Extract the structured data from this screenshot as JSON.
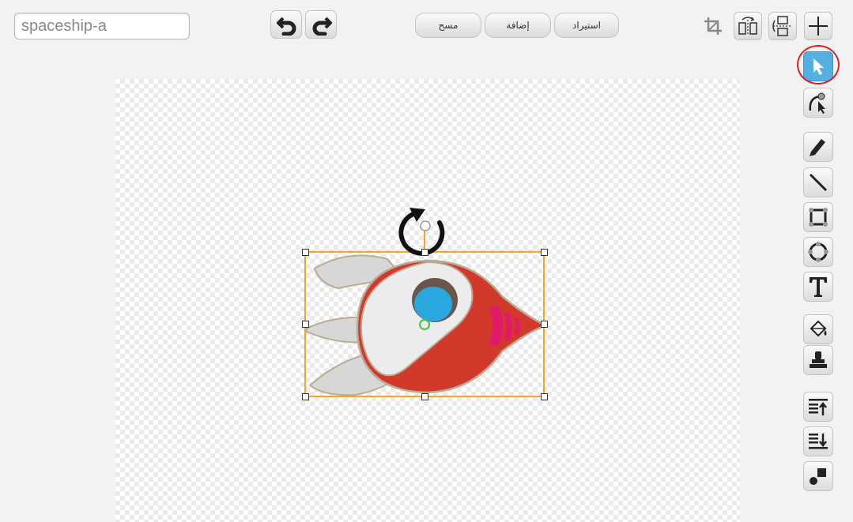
{
  "costume": {
    "name": "spaceship-a"
  },
  "toolbar": {
    "clear_label": "مسح",
    "add_label": "إضافة",
    "import_label": "استيراد"
  },
  "colors": {
    "selection_box": "#f5a623",
    "selected_tool": "#53b0e0",
    "highlight_ring": "#e02020",
    "rocket_body": "#d13a2b",
    "rocket_window": "#29a8e0",
    "rocket_stripes": "#e0196b",
    "rocket_fins": "#d7d7d7"
  },
  "icons": {
    "undo": "undo-icon",
    "redo": "redo-icon",
    "crop": "crop-icon",
    "flip_horizontal": "flip-horizontal-icon",
    "flip_vertical": "flip-vertical-icon",
    "set_center": "crosshair-icon",
    "select": "arrow-cursor-icon",
    "reshape": "reshape-icon",
    "pencil": "pencil-icon",
    "line": "line-icon",
    "rectangle": "rectangle-icon",
    "ellipse": "ellipse-icon",
    "text": "text-icon",
    "fill": "paint-bucket-icon",
    "stamp": "stamp-icon",
    "forward_layer": "bring-forward-icon",
    "back_layer": "send-backward-icon",
    "ungroup": "ungroup-icon"
  }
}
